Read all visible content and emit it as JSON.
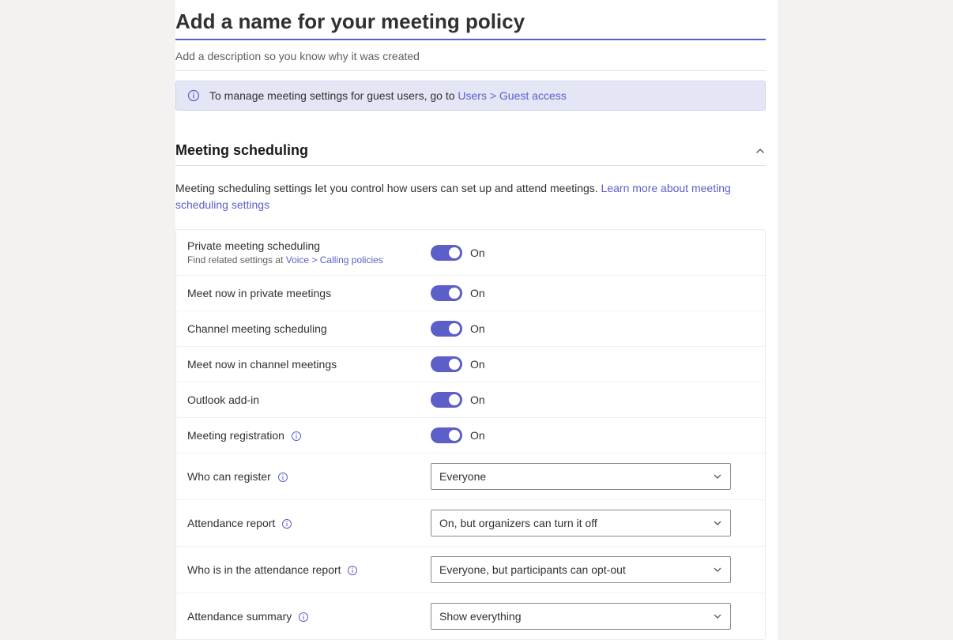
{
  "header": {
    "title_placeholder": "Add a name for your meeting policy",
    "description_placeholder": "Add a description so you know why it was created"
  },
  "banner": {
    "text_prefix": "To manage meeting settings for guest users, go to ",
    "link_text": "Users > Guest access"
  },
  "section": {
    "title": "Meeting scheduling",
    "description_prefix": "Meeting scheduling settings let you control how users can set up and attend meetings. ",
    "description_link": "Learn more about meeting scheduling settings"
  },
  "rows": {
    "private_meeting": {
      "label": "Private meeting scheduling",
      "sub_prefix": "Find related settings at ",
      "sub_link": "Voice > Calling policies",
      "state": "On"
    },
    "meet_now_private": {
      "label": "Meet now in private meetings",
      "state": "On"
    },
    "channel_scheduling": {
      "label": "Channel meeting scheduling",
      "state": "On"
    },
    "meet_now_channel": {
      "label": "Meet now in channel meetings",
      "state": "On"
    },
    "outlook_addin": {
      "label": "Outlook add-in",
      "state": "On"
    },
    "meeting_registration": {
      "label": "Meeting registration",
      "state": "On"
    },
    "who_can_register": {
      "label": "Who can register",
      "value": "Everyone"
    },
    "attendance_report": {
      "label": "Attendance report",
      "value": "On, but organizers can turn it off"
    },
    "who_in_report": {
      "label": "Who is in the attendance report",
      "value": "Everyone, but participants can opt-out"
    },
    "attendance_summary": {
      "label": "Attendance summary",
      "value": "Show everything"
    }
  }
}
